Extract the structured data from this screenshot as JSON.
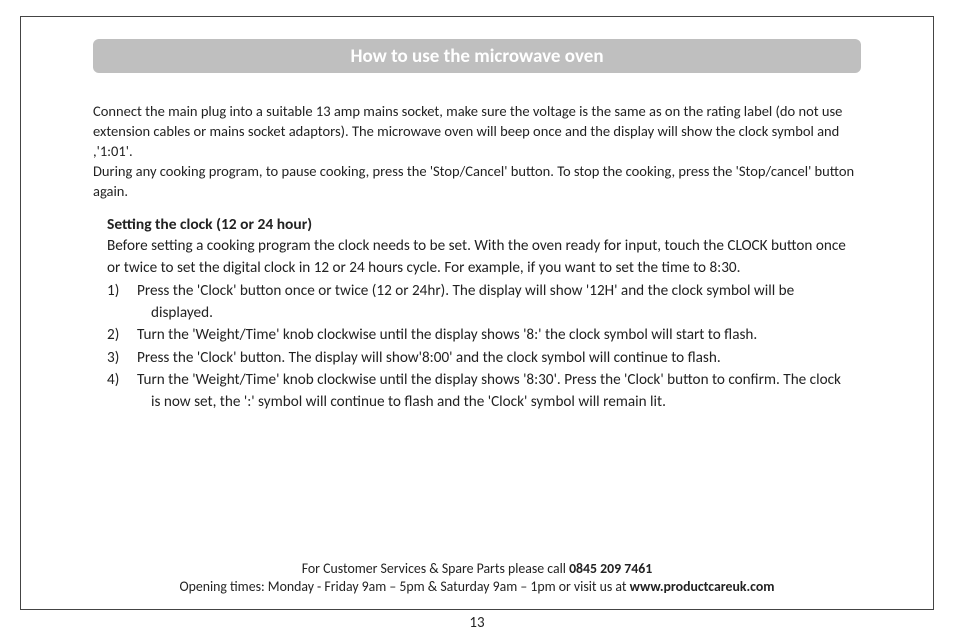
{
  "title": "How to use the microwave oven",
  "intro": "Connect the main plug into a suitable 13 amp mains socket, make sure the voltage is the same as on the rating label (do not use extension cables or mains socket adaptors). The microwave oven will beep once and the display will show the clock symbol and ,'1:01'.\nDuring any cooking program, to pause cooking, press  the  'Stop/Cancel' button. To stop the cooking, press the 'Stop/cancel' button again.",
  "section": {
    "heading": "Setting the clock (12 or 24 hour)",
    "intro": "Before setting a cooking program the clock needs to be set. With the oven ready for input, touch the CLOCK button once or twice to set the digital clock in 12 or 24 hours cycle. For example, if you want to set the time to 8:30.",
    "steps": [
      "Press the 'Clock' button once or twice (12 or 24hr). The display will show '12H' and the clock symbol will be displayed.",
      "Turn the 'Weight/Time' knob clockwise until the display shows '8:' the clock symbol will start to flash.",
      "Press the 'Clock' button. The display will show'8:00' and the clock symbol will continue to flash.",
      "Turn the 'Weight/Time' knob clockwise until the display shows '8:30'. Press the 'Clock' button to confirm. The clock is now set, the ':' symbol will continue to flash and the 'Clock' symbol will remain lit."
    ]
  },
  "footer": {
    "line1_pre": "For Customer Services & Spare Parts please call ",
    "line1_bold": "0845 209 7461",
    "line2_pre": "Opening times: Monday - Friday  9am – 5pm & Saturday 9am – 1pm or visit us at ",
    "line2_bold": "www.productcareuk.com"
  },
  "page_number": "13"
}
